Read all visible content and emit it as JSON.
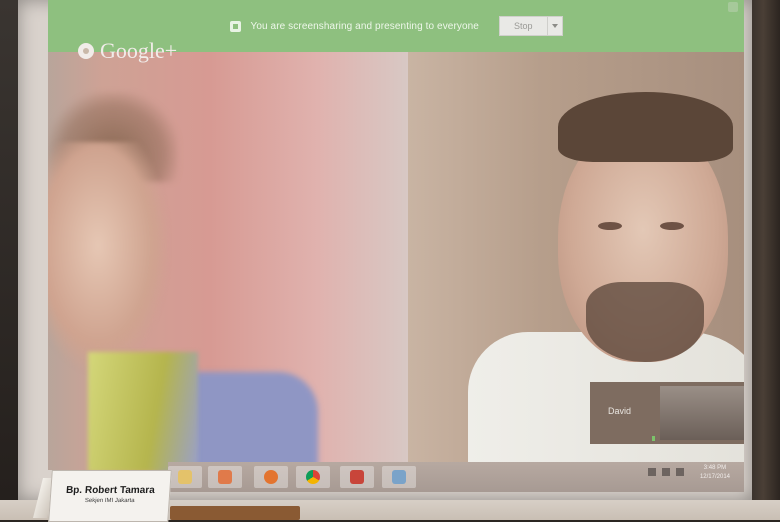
{
  "share_bar": {
    "message": "You are screensharing and presenting to everyone",
    "stop_label": "Stop",
    "color": "#8ec07f"
  },
  "hangout": {
    "brand": "Google+",
    "self_preview_name": "David"
  },
  "taskbar": {
    "apps": [
      "file-explorer-icon",
      "media-player-icon",
      "firefox-icon",
      "chrome-icon",
      "acrobat-icon",
      "photos-icon"
    ],
    "clock_time": "3:48 PM",
    "clock_date": "12/17/2014"
  },
  "nameplate": {
    "name": "Bp. Robert Tamara",
    "subtitle": "Sekjen IMI Jakarta"
  }
}
